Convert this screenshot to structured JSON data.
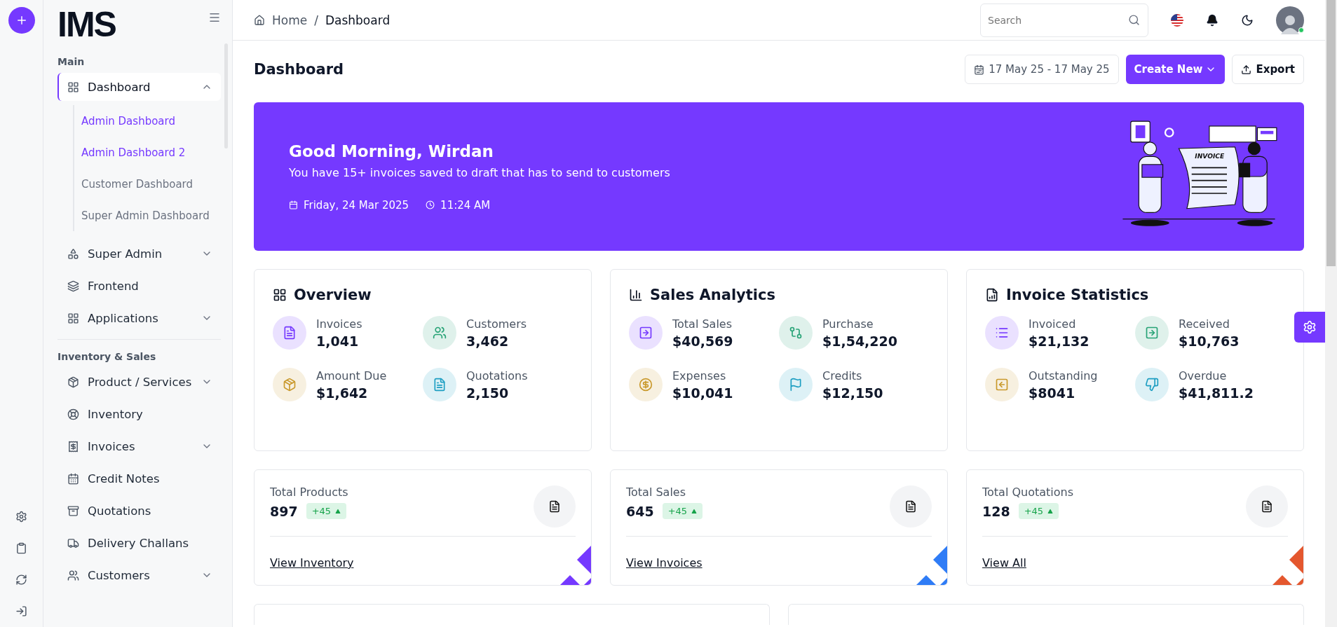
{
  "rail": {
    "items": [
      {
        "kind": "settings"
      },
      {
        "kind": "clipboard"
      },
      {
        "kind": "sync"
      },
      {
        "kind": "logout"
      }
    ]
  },
  "sidebar": {
    "logo": "IMS",
    "sections": [
      {
        "title": "Main",
        "items": [
          {
            "label": "Dashboard",
            "kind": "grid",
            "selected": true,
            "expanded": true,
            "children": [
              {
                "label": "Admin Dashboard",
                "selected": true
              },
              {
                "label": "Admin Dashboard 2",
                "selected": true
              },
              {
                "label": "Customer Dashboard",
                "selected": false
              },
              {
                "label": "Super Admin Dashboard",
                "selected": false
              }
            ]
          },
          {
            "label": "Super Admin",
            "kind": "shapes",
            "selected": false,
            "expanded": false
          },
          {
            "label": "Frontend",
            "kind": "layers",
            "selected": false
          },
          {
            "label": "Applications",
            "kind": "apps",
            "selected": false,
            "expanded": false
          }
        ]
      },
      {
        "title": "Inventory & Sales",
        "items": [
          {
            "label": "Product / Services",
            "kind": "box",
            "selected": false,
            "expanded": false
          },
          {
            "label": "Inventory",
            "kind": "lifebuoy",
            "selected": false
          },
          {
            "label": "Invoices",
            "kind": "receipt",
            "selected": false,
            "expanded": false
          },
          {
            "label": "Credit Notes",
            "kind": "calendar",
            "selected": false
          },
          {
            "label": "Quotations",
            "kind": "archive",
            "selected": false
          },
          {
            "label": "Delivery Challans",
            "kind": "truck",
            "selected": false
          },
          {
            "label": "Customers",
            "kind": "users",
            "selected": false,
            "expanded": false
          }
        ]
      }
    ]
  },
  "topbar": {
    "breadcrumb": [
      "Home",
      "Dashboard"
    ],
    "separator": "/",
    "search": {
      "placeholder": "Search"
    }
  },
  "header": {
    "title": "Dashboard",
    "date_range": "17 May 25 - 17 May 25",
    "create_button": "Create New",
    "export_button": "Export"
  },
  "banner": {
    "greeting": "Good Morning, Wirdan",
    "subtitle": "You have 15+ invoices saved to draft that has to send to customers",
    "date": "Friday, 24 Mar 2025",
    "time": "11:24 AM",
    "illustration_label": "INVOICE"
  },
  "stat_panels": [
    {
      "title": "Overview",
      "kind": "apps",
      "metrics": [
        {
          "label": "Invoices",
          "value": "1,041",
          "kind": "file",
          "color": "#7539ff"
        },
        {
          "label": "Customers",
          "value": "3,462",
          "kind": "users",
          "color": "#27a376"
        },
        {
          "label": "Amount Due",
          "value": "$1,642",
          "kind": "box",
          "color": "#c9992c"
        },
        {
          "label": "Quotations",
          "value": "2,150",
          "kind": "file",
          "color": "#1d9ec2"
        }
      ]
    },
    {
      "title": "Sales Analytics",
      "kind": "chart",
      "metrics": [
        {
          "label": "Total Sales",
          "value": "$40,569",
          "kind": "arrow",
          "color": "#7539ff"
        },
        {
          "label": "Purchase",
          "value": "$1,54,220",
          "kind": "compare",
          "color": "#27a376"
        },
        {
          "label": "Expenses",
          "value": "$10,041",
          "kind": "dollar",
          "color": "#c9992c"
        },
        {
          "label": "Credits",
          "value": "$12,150",
          "kind": "flag",
          "color": "#1d9ec2"
        }
      ]
    },
    {
      "title": "Invoice Statistics",
      "kind": "invoice",
      "metrics": [
        {
          "label": "Invoiced",
          "value": "$21,132",
          "kind": "list",
          "color": "#7539ff"
        },
        {
          "label": "Received",
          "value": "$10,763",
          "kind": "arrow",
          "color": "#27a376"
        },
        {
          "label": "Outstanding",
          "value": "$8041",
          "kind": "back",
          "color": "#c9992c"
        },
        {
          "label": "Overdue",
          "value": "$41,811.2",
          "kind": "thumb",
          "color": "#1d9ec2"
        }
      ]
    }
  ],
  "summary_cards": [
    {
      "label": "Total Products",
      "value": "897",
      "change": "+45",
      "link": "View Inventory",
      "color": "#7539ff"
    },
    {
      "label": "Total Sales",
      "value": "645",
      "change": "+45",
      "link": "View Invoices",
      "color": "#2f7cf6"
    },
    {
      "label": "Total Quotations",
      "value": "128",
      "change": "+45",
      "link": "View All",
      "color": "#e4572e"
    }
  ]
}
